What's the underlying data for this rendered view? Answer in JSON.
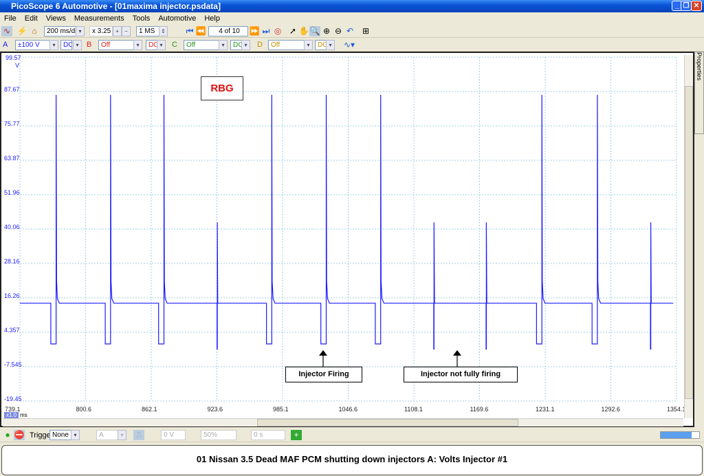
{
  "window": {
    "title": "PicoScope 6 Automotive - [01maxima injector.psdata]",
    "buttons": [
      "_",
      "❐",
      "✕"
    ]
  },
  "menu": [
    "File",
    "Edit",
    "Views",
    "Measurements",
    "Tools",
    "Automotive",
    "Help"
  ],
  "toolbar": {
    "timebase": "200 ms/div",
    "zoom": "x 3.25",
    "samples": "1 MS",
    "buffer": "4 of 10"
  },
  "channels": [
    {
      "label": "A",
      "range": "±100 V",
      "coupling": "DC",
      "color": "#1a1aff"
    },
    {
      "label": "B",
      "range": "Off",
      "coupling": "DC",
      "color": "#e02020"
    },
    {
      "label": "C",
      "range": "Off",
      "coupling": "DC",
      "color": "#209020"
    },
    {
      "label": "D",
      "range": "Off",
      "coupling": "DC",
      "color": "#c09000"
    }
  ],
  "plot": {
    "y_unit": "V",
    "y_ticks": [
      "99.57",
      "87.67",
      "75.77",
      "63.87",
      "51.96",
      "40.06",
      "28.16",
      "16.26",
      "4.357",
      "-7.545",
      "-19.45"
    ],
    "ylim": [
      -19.45,
      99.57
    ],
    "x_unit": "ms",
    "x_zoom": "x1.0",
    "x_ticks": [
      "739.1",
      "800.6",
      "862.1",
      "923.6",
      "985.1",
      "1046.6",
      "1108.1",
      "1169.6",
      "1231.1",
      "1292.6",
      "1354.1"
    ],
    "xlim": [
      739.1,
      1354.1
    ],
    "trace_color": "#1a1aff",
    "baseline_v": 14.4,
    "low_v": 0.3,
    "pulse_width_ms": 5,
    "events": [
      {
        "t": 773,
        "type": "full",
        "peak": 86.5
      },
      {
        "t": 824,
        "type": "full",
        "peak": 86.5
      },
      {
        "t": 874,
        "type": "full",
        "peak": 86.5
      },
      {
        "t": 924,
        "type": "partial",
        "peak": 42.4
      },
      {
        "t": 975,
        "type": "full",
        "peak": 86.5
      },
      {
        "t": 1026,
        "type": "full",
        "peak": 86.5
      },
      {
        "t": 1077,
        "type": "full",
        "peak": 86.5
      },
      {
        "t": 1127,
        "type": "partial",
        "peak": 42.4
      },
      {
        "t": 1176,
        "type": "partial",
        "peak": 42.4
      },
      {
        "t": 1228,
        "type": "full",
        "peak": 86.5
      },
      {
        "t": 1280,
        "type": "full",
        "peak": 86.5
      },
      {
        "t": 1330,
        "type": "partial",
        "peak": 42.4
      }
    ],
    "watermark": "RBG",
    "annotations": [
      "Injector Firing",
      "Injector not fully firing"
    ]
  },
  "bottom_toolbar": {
    "trigger_label": "Trigger",
    "trigger_mode": "None",
    "source": "A",
    "level": "0 V",
    "pretrigger": "50%",
    "delay": "0 s"
  },
  "side_tab": "Properties",
  "caption": "01 Nissan 3.5 Dead MAF  PCM shutting down injectors  A: Volts Injector #1"
}
